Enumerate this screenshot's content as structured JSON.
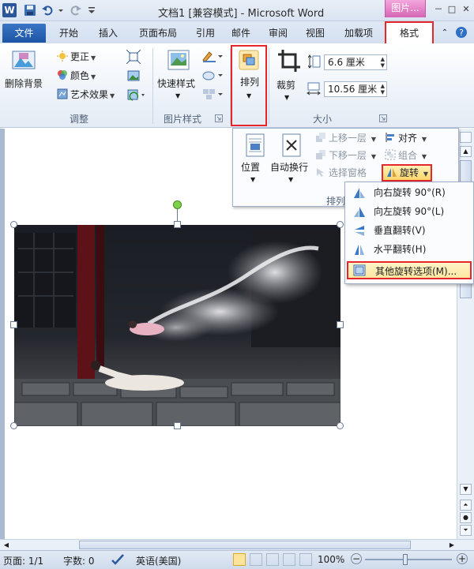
{
  "titlebar": {
    "app_title": "文档1 [兼容模式] - Microsoft Word",
    "context_tab_group": "图片...",
    "word_icon": "word-logo",
    "minimize": "－",
    "restore": "□",
    "close": "✕"
  },
  "tabs": [
    "文件",
    "开始",
    "插入",
    "页面布局",
    "引用",
    "邮件",
    "审阅",
    "视图",
    "加载项",
    "格式"
  ],
  "ribbon": {
    "adjust": {
      "remove_background": "删除背景",
      "corrections": "更正",
      "color": "颜色",
      "artistic_effects": "艺术效果",
      "group_label": "调整"
    },
    "picture_styles": {
      "quick_styles": "快速样式",
      "group_label": "图片样式"
    },
    "arrange": {
      "label": "排列"
    },
    "size": {
      "crop": "裁剪",
      "height": "6.6 厘米",
      "width": "10.56 厘米",
      "group_label": "大小"
    }
  },
  "arrange_dropdown": {
    "position": "位置",
    "wrap_text": "自动换行",
    "bring_forward": "上移一层",
    "send_backward": "下移一层",
    "selection_pane": "选择窗格",
    "align": "对齐",
    "group": "组合",
    "rotate": "旋转",
    "group_label": "排列"
  },
  "rotate_menu": {
    "items": [
      "向右旋转 90°(R)",
      "向左旋转 90°(L)",
      "垂直翻转(V)",
      "水平翻转(H)",
      "其他旋转选项(M)..."
    ]
  },
  "statusbar": {
    "page": "页面: 1/1",
    "words": "字数: 0",
    "language": "英语(美国)",
    "zoom": "100%"
  },
  "colors": {
    "highlight_border": "#e5272d",
    "file_tab": "#1d55a6",
    "context_tab": "#d564b6"
  }
}
